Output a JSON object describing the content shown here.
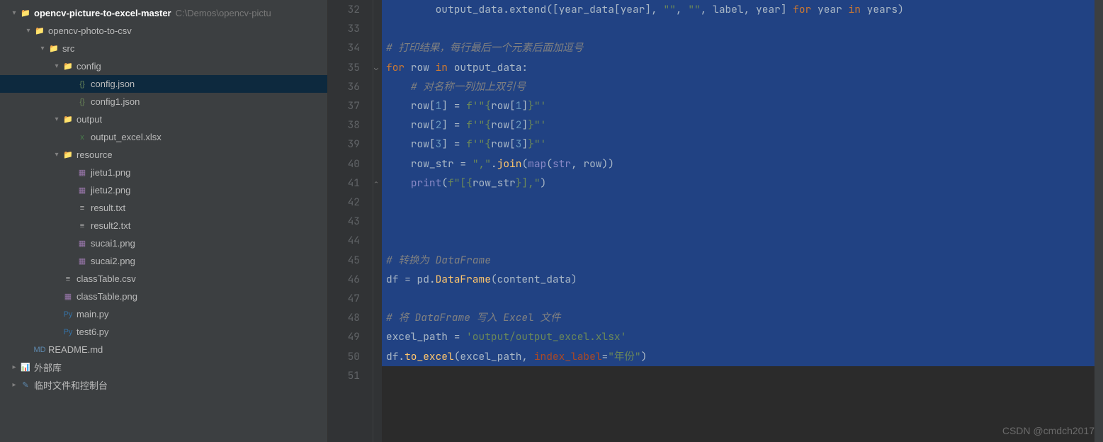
{
  "sidebar": {
    "root": {
      "name": "opencv-picture-to-excel-master",
      "path": "C:\\Demos\\opencv-pictu"
    },
    "items": [
      {
        "level": 0,
        "chev": "down",
        "icon": "folder-module",
        "label": "opencv-picture-to-excel-master",
        "bold": true,
        "path": "C:\\Demos\\opencv-pictu"
      },
      {
        "level": 1,
        "chev": "down",
        "icon": "folder",
        "label": "opencv-photo-to-csv"
      },
      {
        "level": 2,
        "chev": "down",
        "icon": "folder",
        "label": "src"
      },
      {
        "level": 3,
        "chev": "down",
        "icon": "folder",
        "label": "config"
      },
      {
        "level": 4,
        "chev": "none",
        "icon": "json",
        "label": "config.json",
        "selected": true
      },
      {
        "level": 4,
        "chev": "none",
        "icon": "json",
        "label": "config1.json"
      },
      {
        "level": 3,
        "chev": "down",
        "icon": "folder",
        "label": "output"
      },
      {
        "level": 4,
        "chev": "none",
        "icon": "xlsx",
        "label": "output_excel.xlsx"
      },
      {
        "level": 3,
        "chev": "down",
        "icon": "folder",
        "label": "resource"
      },
      {
        "level": 4,
        "chev": "none",
        "icon": "image",
        "label": "jietu1.png"
      },
      {
        "level": 4,
        "chev": "none",
        "icon": "image",
        "label": "jietu2.png"
      },
      {
        "level": 4,
        "chev": "none",
        "icon": "txt",
        "label": "result.txt"
      },
      {
        "level": 4,
        "chev": "none",
        "icon": "txt",
        "label": "result2.txt"
      },
      {
        "level": 4,
        "chev": "none",
        "icon": "image",
        "label": "sucai1.png"
      },
      {
        "level": 4,
        "chev": "none",
        "icon": "image",
        "label": "sucai2.png"
      },
      {
        "level": 3,
        "chev": "none",
        "icon": "csv",
        "label": "classTable.csv"
      },
      {
        "level": 3,
        "chev": "none",
        "icon": "image",
        "label": "classTable.png"
      },
      {
        "level": 3,
        "chev": "none",
        "icon": "py",
        "label": "main.py"
      },
      {
        "level": 3,
        "chev": "none",
        "icon": "py",
        "label": "test6.py"
      },
      {
        "level": 1,
        "chev": "none",
        "icon": "md",
        "label": "README.md"
      },
      {
        "level": 0,
        "chev": "right",
        "icon": "lib",
        "label": "外部库"
      },
      {
        "level": 0,
        "chev": "right",
        "icon": "scratch",
        "label": "临时文件和控制台"
      }
    ]
  },
  "editor": {
    "firstLine": 32,
    "lines": [
      {
        "n": 32,
        "sel": true,
        "tokens": [
          [
            "default",
            "        output_data.extend([year_data[year], "
          ],
          [
            "str",
            "\"\""
          ],
          [
            "default",
            ", "
          ],
          [
            "str",
            "\"\""
          ],
          [
            "default",
            ", label, year] "
          ],
          [
            "kw",
            "for"
          ],
          [
            "default",
            " year "
          ],
          [
            "kw",
            "in"
          ],
          [
            "default",
            " years)"
          ]
        ]
      },
      {
        "n": 33,
        "sel": true,
        "tokens": []
      },
      {
        "n": 34,
        "sel": true,
        "tokens": [
          [
            "cmt",
            "# 打印结果，每行最后一个元素后面加逗号"
          ]
        ]
      },
      {
        "n": 35,
        "sel": true,
        "fold": "down",
        "tokens": [
          [
            "kw",
            "for"
          ],
          [
            "default",
            " row "
          ],
          [
            "kw",
            "in"
          ],
          [
            "default",
            " output_data:"
          ]
        ]
      },
      {
        "n": 36,
        "sel": true,
        "tokens": [
          [
            "default",
            "    "
          ],
          [
            "cmt",
            "# 对名称一列加上双引号"
          ]
        ]
      },
      {
        "n": 37,
        "sel": true,
        "tokens": [
          [
            "default",
            "    row["
          ],
          [
            "num",
            "1"
          ],
          [
            "default",
            "] = "
          ],
          [
            "str",
            "f'\"{"
          ],
          [
            "default",
            "row["
          ],
          [
            "num",
            "1"
          ],
          [
            "default",
            "]"
          ],
          [
            "str",
            "}\"'"
          ]
        ]
      },
      {
        "n": 38,
        "sel": true,
        "tokens": [
          [
            "default",
            "    row["
          ],
          [
            "num",
            "2"
          ],
          [
            "default",
            "] = "
          ],
          [
            "str",
            "f'\"{"
          ],
          [
            "default",
            "row["
          ],
          [
            "num",
            "2"
          ],
          [
            "default",
            "]"
          ],
          [
            "str",
            "}\"'"
          ]
        ]
      },
      {
        "n": 39,
        "sel": true,
        "tokens": [
          [
            "default",
            "    row["
          ],
          [
            "num",
            "3"
          ],
          [
            "default",
            "] = "
          ],
          [
            "str",
            "f'\"{"
          ],
          [
            "default",
            "row["
          ],
          [
            "num",
            "3"
          ],
          [
            "default",
            "]"
          ],
          [
            "str",
            "}\"'"
          ]
        ]
      },
      {
        "n": 40,
        "sel": true,
        "tokens": [
          [
            "default",
            "    row_str = "
          ],
          [
            "str",
            "\",\""
          ],
          [
            "default",
            "."
          ],
          [
            "fn",
            "join"
          ],
          [
            "default",
            "("
          ],
          [
            "builtin",
            "map"
          ],
          [
            "default",
            "("
          ],
          [
            "builtin",
            "str"
          ],
          [
            "default",
            ", row))"
          ]
        ]
      },
      {
        "n": 41,
        "sel": true,
        "fold": "up",
        "tokens": [
          [
            "default",
            "    "
          ],
          [
            "builtin",
            "print"
          ],
          [
            "default",
            "("
          ],
          [
            "str",
            "f\"[{"
          ],
          [
            "default",
            "row_str"
          ],
          [
            "str",
            "}],\""
          ],
          [
            "default",
            ")"
          ]
        ]
      },
      {
        "n": 42,
        "sel": true,
        "tokens": []
      },
      {
        "n": 43,
        "sel": true,
        "tokens": []
      },
      {
        "n": 44,
        "sel": true,
        "tokens": []
      },
      {
        "n": 45,
        "sel": true,
        "tokens": [
          [
            "cmt",
            "# 转换为 DataFrame"
          ]
        ]
      },
      {
        "n": 46,
        "sel": true,
        "tokens": [
          [
            "default",
            "df = pd."
          ],
          [
            "fn",
            "DataFrame"
          ],
          [
            "default",
            "(content_data)"
          ]
        ]
      },
      {
        "n": 47,
        "sel": true,
        "tokens": []
      },
      {
        "n": 48,
        "sel": true,
        "tokens": [
          [
            "cmt",
            "# 将 DataFrame 写入 Excel 文件"
          ]
        ]
      },
      {
        "n": 49,
        "sel": true,
        "tokens": [
          [
            "default",
            "excel_path = "
          ],
          [
            "str",
            "'output/output_excel.xlsx'"
          ]
        ]
      },
      {
        "n": 50,
        "sel": true,
        "tokens": [
          [
            "default",
            "df."
          ],
          [
            "fn",
            "to_excel"
          ],
          [
            "default",
            "(excel_path, "
          ],
          [
            "param",
            "index_label"
          ],
          [
            "default",
            "="
          ],
          [
            "str",
            "\"年份\""
          ],
          [
            "default",
            ")"
          ]
        ]
      },
      {
        "n": 51,
        "sel": false,
        "tokens": []
      }
    ]
  },
  "watermark": "CSDN @cmdch2017",
  "icons": {
    "folder": "📁",
    "folder-module": "📁",
    "json": "{}",
    "xlsx": "x",
    "image": "▦",
    "txt": "≡",
    "csv": "≡",
    "py": "Py",
    "md": "MD",
    "lib": "📊",
    "scratch": "✎"
  }
}
